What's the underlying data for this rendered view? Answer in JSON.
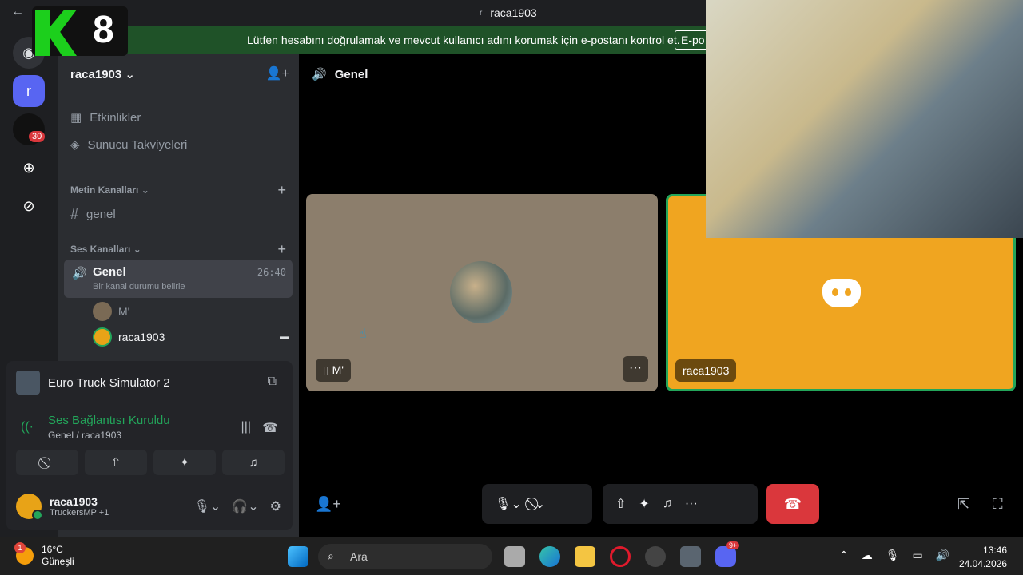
{
  "window": {
    "title": "raca1903",
    "title_icon": "r",
    "back": "←"
  },
  "banner": {
    "text": "Lütfen hesabını doğrulamak ve mevcut kullanıcı adını korumak için e-postanı kontrol et.",
    "button": "E-po"
  },
  "overlay": {
    "logo_number": "8"
  },
  "guilds": {
    "active_initial": "r",
    "badge": "30"
  },
  "sidebar": {
    "server_name": "raca1903",
    "items": [
      {
        "label": "Etkinlikler"
      },
      {
        "label": "Sunucu Takviyeleri"
      }
    ],
    "text_category": "Metin Kanalları",
    "text_channel": "genel",
    "voice_category": "Ses Kanalları",
    "voice_channel": {
      "name": "Genel",
      "status": "Bir kanal durumu belirle",
      "time": "26:40"
    },
    "members": [
      "M'",
      "raca1903"
    ]
  },
  "activity": {
    "game": "Euro Truck Simulator 2"
  },
  "voice_status": {
    "title": "Ses Bağlantısı Kuruldu",
    "sub": "Genel / raca1903"
  },
  "user": {
    "name": "raca1903",
    "status": "TruckersMP +1"
  },
  "stage": {
    "title": "Genel",
    "tile1_label": "M'",
    "tile2_label": "raca1903",
    "more": "···"
  },
  "taskbar": {
    "temp": "16°C",
    "weather": "Güneşli",
    "weather_badge": "1",
    "search": "Ara",
    "discord_badge": "9+",
    "time": "13:46",
    "date": "24.04.2026"
  },
  "colors": {
    "green": "#23a55a",
    "orange": "#f0a520",
    "red": "#da373c",
    "bg": "#2b2d31"
  }
}
